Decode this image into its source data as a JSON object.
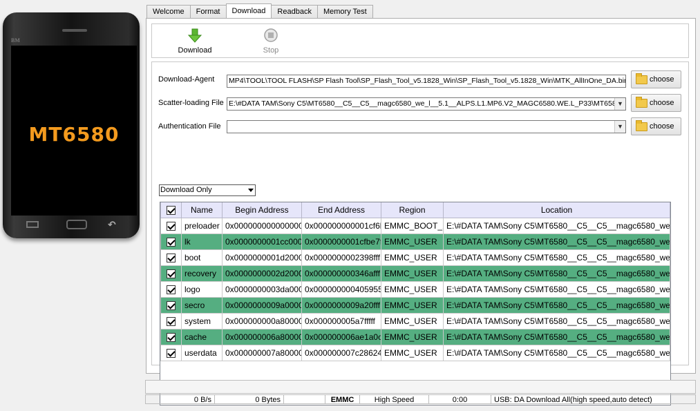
{
  "phone": {
    "brand": "BM",
    "model": "MT6580"
  },
  "tabs": [
    {
      "label": "Welcome"
    },
    {
      "label": "Format"
    },
    {
      "label": "Download"
    },
    {
      "label": "Readback"
    },
    {
      "label": "Memory Test"
    }
  ],
  "toolbar": {
    "download_label": "Download",
    "stop_label": "Stop"
  },
  "form": {
    "download_agent": {
      "label": "Download-Agent",
      "value": "MP4\\TOOL\\TOOL FLASH\\SP Flash Tool\\SP_Flash_Tool_v5.1828_Win\\SP_Flash_Tool_v5.1828_Win\\MTK_AllInOne_DA.bin"
    },
    "scatter_file": {
      "label": "Scatter-loading File",
      "value": "E:\\#DATA TAM\\Sony C5\\MT6580__C5__C5__magc6580_we_l__5.1__ALPS.L1.MP6.V2_MAGC6580.WE.L_P33\\MT6580"
    },
    "auth_file": {
      "label": "Authentication File",
      "value": ""
    },
    "choose_label": "choose",
    "mode": "Download Only"
  },
  "table": {
    "headers": [
      "Name",
      "Begin Address",
      "End Address",
      "Region",
      "Location"
    ],
    "rows": [
      {
        "name": "preloader",
        "begin": "0x0000000000000000",
        "end": "0x000000000001cf6b",
        "region": "EMMC_BOOT_1",
        "location": "E:\\#DATA TAM\\Sony C5\\MT6580__C5__C5__magc6580_we_...",
        "green": false
      },
      {
        "name": "lk",
        "begin": "0x0000000001cc0000",
        "end": "0x0000000001cfbe7f",
        "region": "EMMC_USER",
        "location": "E:\\#DATA TAM\\Sony C5\\MT6580__C5__C5__magc6580_we_...",
        "green": true
      },
      {
        "name": "boot",
        "begin": "0x0000000001d20000",
        "end": "0x0000000002398fff",
        "region": "EMMC_USER",
        "location": "E:\\#DATA TAM\\Sony C5\\MT6580__C5__C5__magc6580_we_...",
        "green": false
      },
      {
        "name": "recovery",
        "begin": "0x0000000002d20000",
        "end": "0x000000000346afff",
        "region": "EMMC_USER",
        "location": "E:\\#DATA TAM\\Sony C5\\MT6580__C5__C5__magc6580_we_...",
        "green": true
      },
      {
        "name": "logo",
        "begin": "0x0000000003da0000",
        "end": "0x000000000405955d",
        "region": "EMMC_USER",
        "location": "E:\\#DATA TAM\\Sony C5\\MT6580__C5__C5__magc6580_we_...",
        "green": false
      },
      {
        "name": "secro",
        "begin": "0x0000000009a00000",
        "end": "0x0000000009a20fff",
        "region": "EMMC_USER",
        "location": "E:\\#DATA TAM\\Sony C5\\MT6580__C5__C5__magc6580_we_...",
        "green": true
      },
      {
        "name": "system",
        "begin": "0x000000000a800000",
        "end": "0x000000005a7fffff",
        "region": "EMMC_USER",
        "location": "E:\\#DATA TAM\\Sony C5\\MT6580__C5__C5__magc6580_we_...",
        "green": false
      },
      {
        "name": "cache",
        "begin": "0x000000006a800000",
        "end": "0x000000006ae1a0cf",
        "region": "EMMC_USER",
        "location": "E:\\#DATA TAM\\Sony C5\\MT6580__C5__C5__magc6580_we_...",
        "green": true
      },
      {
        "name": "userdata",
        "begin": "0x000000007a800000",
        "end": "0x000000007c28624f",
        "region": "EMMC_USER",
        "location": "E:\\#DATA TAM\\Sony C5\\MT6580__C5__C5__magc6580_we_...",
        "green": false
      }
    ]
  },
  "status": {
    "speed": "0 B/s",
    "bytes": "0 Bytes",
    "storage": "EMMC",
    "mode": "High Speed",
    "time": "0:00",
    "connection": "USB: DA Download All(high speed,auto detect)"
  },
  "colors": {
    "row_highlight": "#55ae81",
    "header_bg": "#e6e6fa",
    "phone_text": "#f39a1e"
  }
}
